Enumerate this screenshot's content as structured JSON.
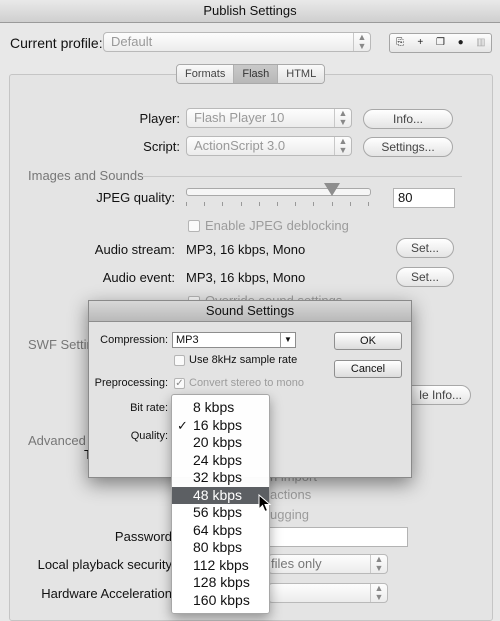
{
  "window": {
    "title": "Publish Settings"
  },
  "profile": {
    "label": "Current profile:",
    "value": "Default"
  },
  "tabs": [
    "Formats",
    "Flash",
    "HTML"
  ],
  "player": {
    "label": "Player:",
    "value": "Flash Player 10",
    "button": "Info..."
  },
  "script": {
    "label": "Script:",
    "value": "ActionScript 3.0",
    "button": "Settings..."
  },
  "images_sounds": {
    "heading": "Images and Sounds",
    "jpeg_label": "JPEG quality:",
    "jpeg_value": "80",
    "jpeg_slider_fraction": 0.8,
    "deblock_label": "Enable JPEG deblocking",
    "audio_stream_label": "Audio stream:",
    "audio_stream_value": "MP3, 16 kbps, Mono",
    "audio_event_label": "Audio event:",
    "audio_event_value": "MP3, 16 kbps, Mono",
    "set_button": "Set...",
    "override_partial": "Override sound settings"
  },
  "swf": {
    "heading_partial": "SWF Settin",
    "info_partial": "le Info..."
  },
  "advanced": {
    "heading_partial": "Advanced",
    "t_partial": "T",
    "import_partial": "n import",
    "actions_partial": "actions",
    "debugging_partial": "ugging",
    "password_label": "Password",
    "local_playback_label": "Local playback security",
    "local_playback_value_partial": "files only",
    "hw_accel_label": "Hardware Acceleration"
  },
  "dialog": {
    "title": "Sound Settings",
    "compression_label": "Compression:",
    "compression_value": "MP3",
    "use8k_label": "Use 8kHz sample rate",
    "preprocessing_label": "Preprocessing:",
    "convert_label": "Convert stereo to mono",
    "bitrate_label": "Bit rate:",
    "quality_label": "Quality:",
    "ok": "OK",
    "cancel": "Cancel"
  },
  "bitrate_menu": {
    "items": [
      "8 kbps",
      "16 kbps",
      "20 kbps",
      "24 kbps",
      "32 kbps",
      "48 kbps",
      "56 kbps",
      "64 kbps",
      "80 kbps",
      "112 kbps",
      "128 kbps",
      "160 kbps"
    ],
    "checked": "16 kbps",
    "highlighted": "48 kbps"
  },
  "icons": {
    "checkmark": "✓",
    "arrows": "up-down-arrows-icon"
  }
}
